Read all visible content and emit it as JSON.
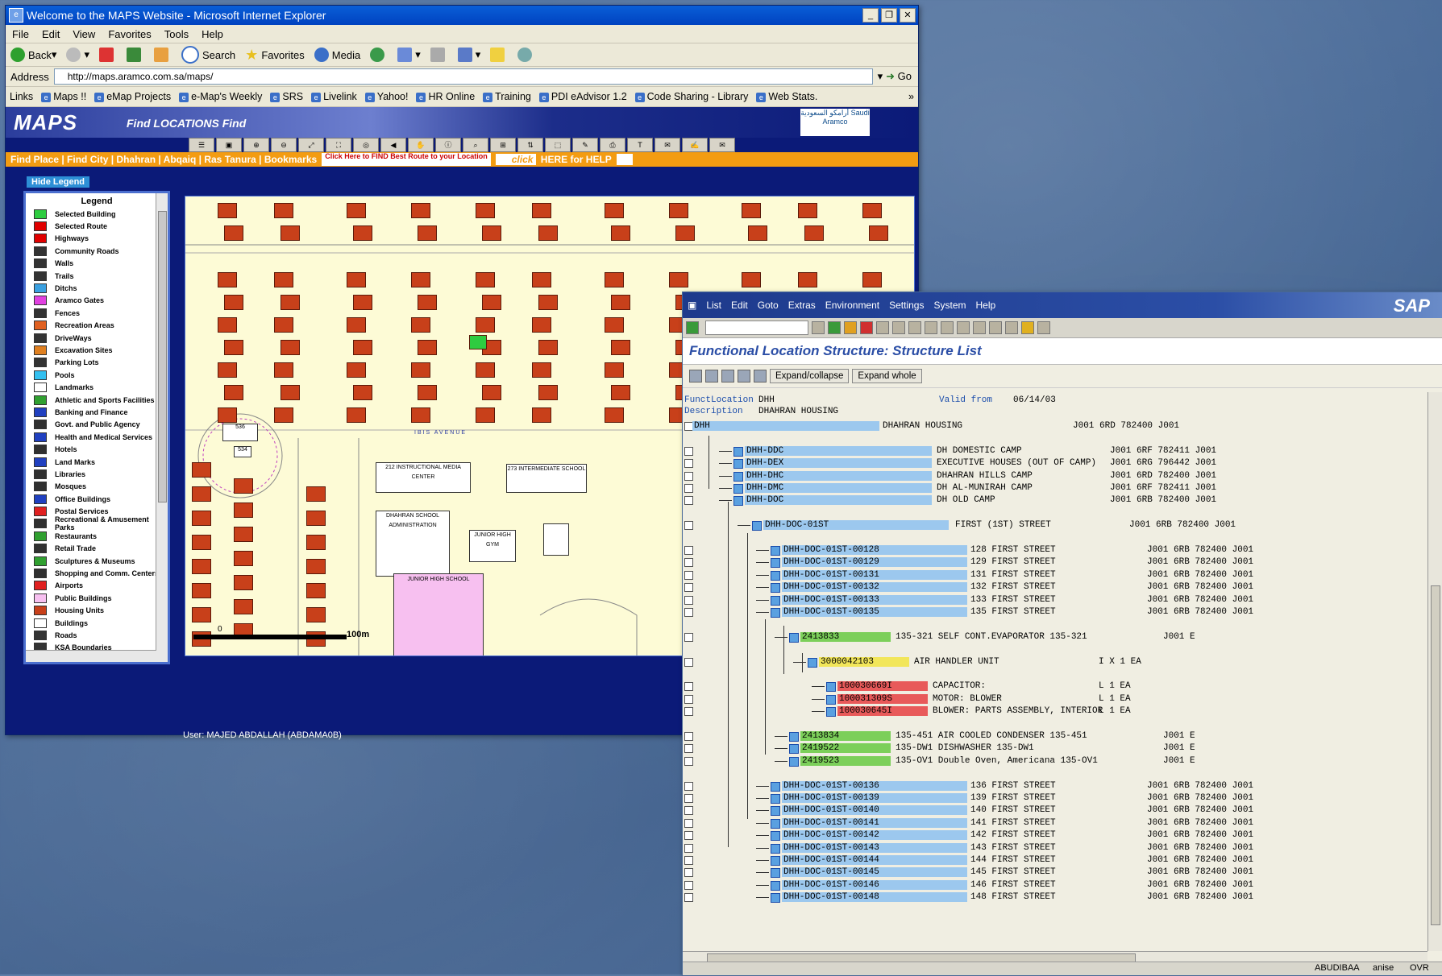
{
  "ie": {
    "title": "Welcome to the MAPS Website - Microsoft Internet Explorer",
    "menu": [
      "File",
      "Edit",
      "View",
      "Favorites",
      "Tools",
      "Help"
    ],
    "toolbar": {
      "back": "Back",
      "search": "Search",
      "favorites": "Favorites",
      "media": "Media"
    },
    "address_label": "Address",
    "address": "http://maps.aramco.com.sa/maps/",
    "go": "Go",
    "links_label": "Links",
    "links": [
      "Maps !!",
      "eMap Projects",
      "e-Map's Weekly",
      "SRS",
      "Livelink",
      "Yahoo!",
      "HR Online",
      "Training",
      "PDI eAdvisor 1.2",
      "Code Sharing - Library",
      "Web Stats."
    ]
  },
  "maps": {
    "logo": "MAPS",
    "find": "Find LOCATIONS Find",
    "aramco": "أرامكو السعودية Saudi Aramco",
    "nav": "Find Place | Find City | Dhahran | Abqaiq | Ras Tanura | Bookmarks",
    "best_route": "Click Here to FIND Best Route to your Location",
    "help_click": "click",
    "help": "HERE for HELP",
    "hide_legend": "Hide Legend",
    "legend_title": "Legend",
    "legend": [
      {
        "label": "Selected Building",
        "color": "#2ecc40"
      },
      {
        "label": "Selected Route",
        "color": "#e00000"
      },
      {
        "label": "Highways",
        "color": "#e00000"
      },
      {
        "label": "Community Roads",
        "color": "#333333"
      },
      {
        "label": "Walls",
        "color": "#333333"
      },
      {
        "label": "Trails",
        "color": "#333333"
      },
      {
        "label": "Ditchs",
        "color": "#3aa0e0"
      },
      {
        "label": "Aramco Gates",
        "color": "#e040e0"
      },
      {
        "label": "Fences",
        "color": "#333333"
      },
      {
        "label": "Recreation Areas",
        "color": "#e06020"
      },
      {
        "label": "DriveWays",
        "color": "#333333"
      },
      {
        "label": "Excavation Sites",
        "color": "#e08020"
      },
      {
        "label": "Parking Lots",
        "color": "#333333"
      },
      {
        "label": "Pools",
        "color": "#33c0f0"
      },
      {
        "label": "Landmarks",
        "color": "#ffffff"
      },
      {
        "label": "Athletic and Sports Facilities",
        "color": "#30a030"
      },
      {
        "label": "Banking and Finance",
        "color": "#2040c0"
      },
      {
        "label": "Govt. and Public Agency",
        "color": "#303030"
      },
      {
        "label": "Health and Medical Services",
        "color": "#2040c0"
      },
      {
        "label": "Hotels",
        "color": "#303030"
      },
      {
        "label": "Land Marks",
        "color": "#2040c0"
      },
      {
        "label": "Libraries",
        "color": "#303030"
      },
      {
        "label": "Mosques",
        "color": "#303030"
      },
      {
        "label": "Office Buildings",
        "color": "#2040c0"
      },
      {
        "label": "Postal Services",
        "color": "#e02020"
      },
      {
        "label": "Recreational & Amusement Parks",
        "color": "#303030"
      },
      {
        "label": "Restaurants",
        "color": "#30a030"
      },
      {
        "label": "Retail Trade",
        "color": "#303030"
      },
      {
        "label": "Sculptures & Museums",
        "color": "#30a030"
      },
      {
        "label": "Shopping and Comm. Centers",
        "color": "#303030"
      },
      {
        "label": "Airports",
        "color": "#e02020"
      },
      {
        "label": "Public Buildings",
        "color": "#f7c0f0"
      },
      {
        "label": "Housing Units",
        "color": "#c8401a"
      },
      {
        "label": "Buildings",
        "color": "#ffffff"
      },
      {
        "label": "Roads",
        "color": "#333333"
      },
      {
        "label": "KSA Boundaries",
        "color": "#333333"
      }
    ],
    "scale_start": "0",
    "scale_end": "100m",
    "street_label": "IBIS AVENUE",
    "bldg1": "212 INSTRUCTIONAL MEDIA CENTER",
    "bldg2": "273 INTERMEDIATE SCHOOL",
    "bldg3": "DHAHRAN SCHOOL ADMINISTRATION",
    "bldg4": "JUNIOR HIGH GYM",
    "bldg5": "JUNIOR HIGH SCHOOL",
    "user": "User: MAJED ABDALLAH (ABDAMA0B)"
  },
  "sap": {
    "menu": [
      "List",
      "Edit",
      "Goto",
      "Extras",
      "Environment",
      "Settings",
      "System",
      "Help"
    ],
    "logo": "SAP",
    "title": "Functional Location Structure: Structure List",
    "btn_expand": "Expand/collapse",
    "btn_whole": "Expand whole",
    "funct_label": "FunctLocation",
    "funct_value": "DHH",
    "valid_label": "Valid from",
    "valid_value": "06/14/03",
    "desc_label": "Description",
    "desc_value": "DHAHRAN HOUSING",
    "rows": [
      {
        "id": "DHH",
        "desc": "DHAHRAN HOUSING",
        "code": "J001 6RD 782400    J001"
      },
      {
        "id": "DHH-DDC",
        "desc": "DH DOMESTIC CAMP",
        "code": "J001 6RF 782411    J001"
      },
      {
        "id": "DHH-DEX",
        "desc": "EXECUTIVE HOUSES (OUT OF CAMP)",
        "code": "J001 6RG 796442    J001"
      },
      {
        "id": "DHH-DHC",
        "desc": "DHAHRAN HILLS CAMP",
        "code": "J001 6RD 782400    J001"
      },
      {
        "id": "DHH-DMC",
        "desc": "DH AL-MUNIRAH CAMP",
        "code": "J001 6RF 782411    J001"
      },
      {
        "id": "DHH-DOC",
        "desc": "DH OLD CAMP",
        "code": "J001 6RB 782400    J001"
      },
      {
        "id": "DHH-DOC-01ST",
        "desc": "FIRST (1ST) STREET",
        "code": "J001 6RB 782400    J001"
      },
      {
        "id": "DHH-DOC-01ST-00128",
        "desc": "128 FIRST STREET",
        "code": "J001 6RB 782400    J001"
      },
      {
        "id": "DHH-DOC-01ST-00129",
        "desc": "129 FIRST STREET",
        "code": "J001 6RB 782400    J001"
      },
      {
        "id": "DHH-DOC-01ST-00131",
        "desc": "131 FIRST STREET",
        "code": "J001 6RB 782400    J001"
      },
      {
        "id": "DHH-DOC-01ST-00132",
        "desc": "132 FIRST STREET",
        "code": "J001 6RB 782400    J001"
      },
      {
        "id": "DHH-DOC-01ST-00133",
        "desc": "133 FIRST STREET",
        "code": "J001 6RB 782400    J001"
      },
      {
        "id": "DHH-DOC-01ST-00135",
        "desc": "135 FIRST STREET",
        "code": "J001 6RB 782400    J001"
      },
      {
        "id": "2413833",
        "desc": "135-321 SELF CONT.EVAPORATOR       135-321",
        "code": "J001 E"
      },
      {
        "id": "3000042103",
        "desc": "AIR HANDLER UNIT",
        "code": "I   X              1   EA"
      },
      {
        "id": "100030669I",
        "desc": "CAPACITOR:",
        "code": "L                   1   EA"
      },
      {
        "id": "100031309S",
        "desc": "MOTOR: BLOWER",
        "code": "L                   1   EA"
      },
      {
        "id": "100030645I",
        "desc": "BLOWER: PARTS ASSEMBLY, INTERIOR",
        "code": "L                   1   EA"
      },
      {
        "id": "2413834",
        "desc": "135-451 AIR COOLED CONDENSER       135-451",
        "code": "J001 E"
      },
      {
        "id": "2419522",
        "desc": "135-DW1 DISHWASHER                 135-DW1",
        "code": "J001 E"
      },
      {
        "id": "2419523",
        "desc": "135-OV1 Double Oven, Americana     135-OV1",
        "code": "J001 E"
      },
      {
        "id": "DHH-DOC-01ST-00136",
        "desc": "136 FIRST STREET",
        "code": "J001 6RB 782400    J001"
      },
      {
        "id": "DHH-DOC-01ST-00139",
        "desc": "139 FIRST STREET",
        "code": "J001 6RB 782400    J001"
      },
      {
        "id": "DHH-DOC-01ST-00140",
        "desc": "140 FIRST STREET",
        "code": "J001 6RB 782400    J001"
      },
      {
        "id": "DHH-DOC-01ST-00141",
        "desc": "141 FIRST STREET",
        "code": "J001 6RB 782400    J001"
      },
      {
        "id": "DHH-DOC-01ST-00142",
        "desc": "142 FIRST STREET",
        "code": "J001 6RB 782400    J001"
      },
      {
        "id": "DHH-DOC-01ST-00143",
        "desc": "143 FIRST STREET",
        "code": "J001 6RB 782400    J001"
      },
      {
        "id": "DHH-DOC-01ST-00144",
        "desc": "144 FIRST STREET",
        "code": "J001 6RB 782400    J001"
      },
      {
        "id": "DHH-DOC-01ST-00145",
        "desc": "145 FIRST STREET",
        "code": "J001 6RB 782400    J001"
      },
      {
        "id": "DHH-DOC-01ST-00146",
        "desc": "146 FIRST STREET",
        "code": "J001 6RB 782400    J001"
      },
      {
        "id": "DHH-DOC-01ST-00148",
        "desc": "148 FIRST STREET",
        "code": "J001 6RB 782400    J001"
      }
    ],
    "status": {
      "user": "ABUDIBAA",
      "server": "anise",
      "mode": "OVR"
    }
  }
}
